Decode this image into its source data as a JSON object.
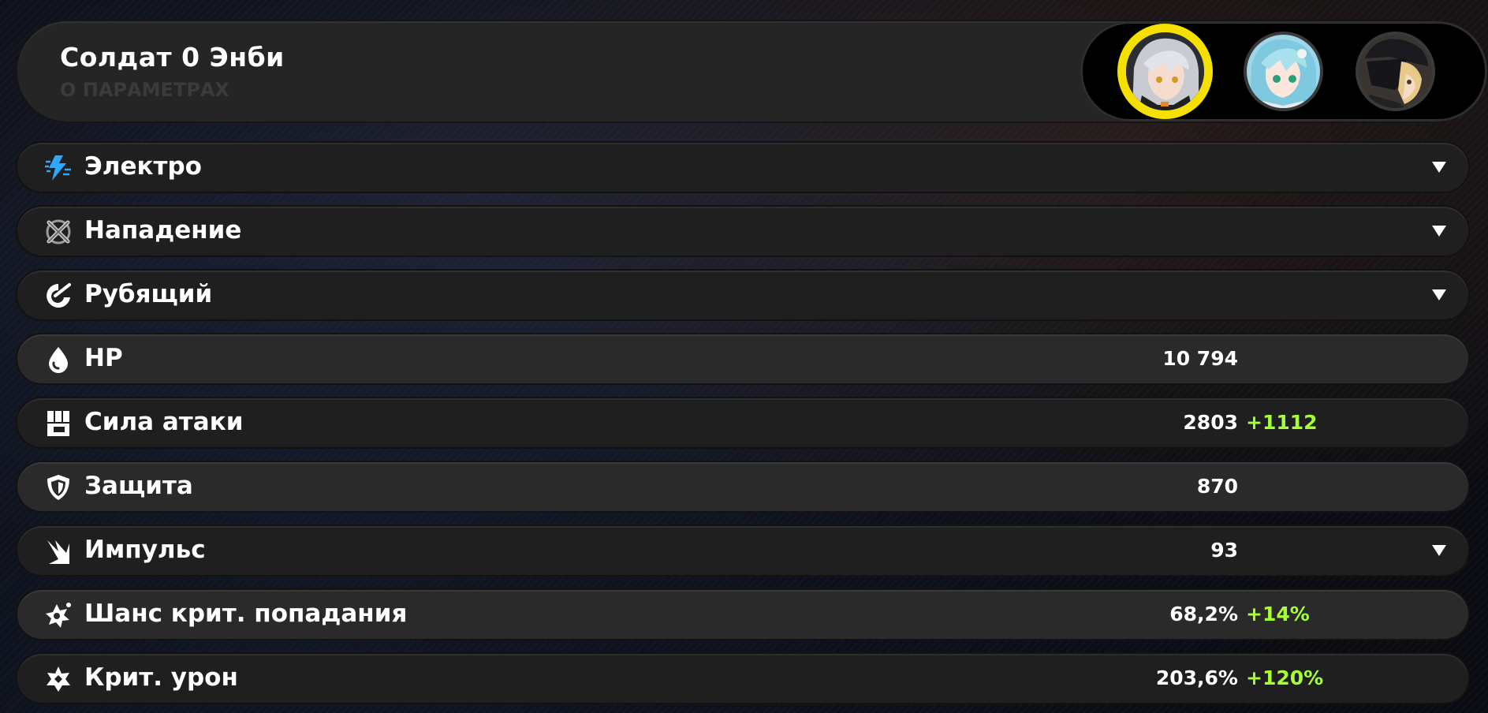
{
  "header": {
    "title": "Солдат 0 Энби",
    "subtitle": "О ПАРАМЕТРАХ",
    "accent_color": "#f5e000"
  },
  "avatars": [
    {
      "name": "agent-portrait-1",
      "selected": true
    },
    {
      "name": "agent-portrait-2",
      "selected": false
    },
    {
      "name": "agent-portrait-3",
      "selected": false
    }
  ],
  "rows": [
    {
      "icon": "electric-icon",
      "label": "Электро",
      "value": "",
      "bonus": "",
      "expandable": true
    },
    {
      "icon": "attack-type-icon",
      "label": "Нападение",
      "value": "",
      "bonus": "",
      "expandable": true
    },
    {
      "icon": "slash-icon",
      "label": "Рубящий",
      "value": "",
      "bonus": "",
      "expandable": true
    },
    {
      "icon": "hp-drop-icon",
      "label": "HP",
      "value": "10 794",
      "bonus": "",
      "expandable": false
    },
    {
      "icon": "attack-fist-icon",
      "label": "Сила атаки",
      "value": "2803",
      "bonus": "+1112",
      "expandable": false
    },
    {
      "icon": "shield-icon",
      "label": "Защита",
      "value": "870",
      "bonus": "",
      "expandable": false
    },
    {
      "icon": "impulse-icon",
      "label": "Импульс",
      "value": "93",
      "bonus": "",
      "expandable": true
    },
    {
      "icon": "crit-rate-icon",
      "label": "Шанс крит. попадания",
      "value": "68,2%",
      "bonus": "+14%",
      "expandable": false
    },
    {
      "icon": "crit-dmg-icon",
      "label": "Крит. урон",
      "value": "203,6%",
      "bonus": "+120%",
      "expandable": false
    }
  ],
  "colors": {
    "bonus": "#a6ff33",
    "electric": "#2ea8ff"
  }
}
